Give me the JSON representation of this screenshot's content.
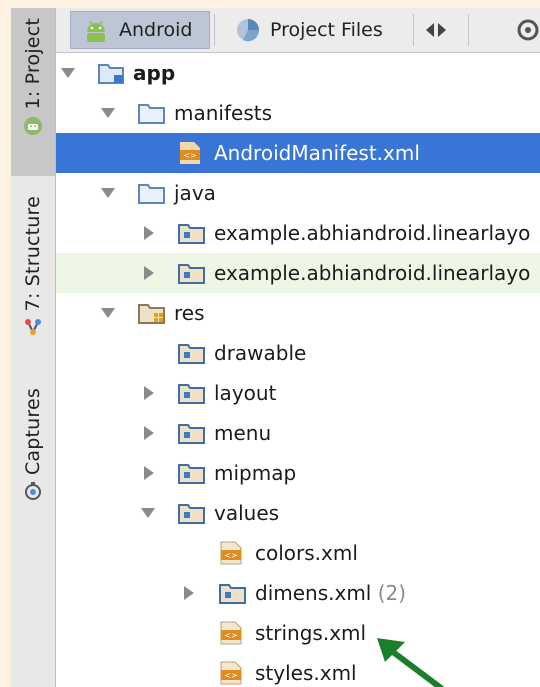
{
  "side_tabs": [
    {
      "label": "1: Project"
    },
    {
      "label": "7: Structure"
    },
    {
      "label": "Captures"
    }
  ],
  "toolbar": {
    "tabs": [
      {
        "label": "Android"
      },
      {
        "label": "Project Files"
      }
    ]
  },
  "tree": {
    "rows": [
      {
        "label": "app"
      },
      {
        "label": "manifests"
      },
      {
        "label": "AndroidManifest.xml"
      },
      {
        "label": "java"
      },
      {
        "label": "example.abhiandroid.linearlayo"
      },
      {
        "label": "example.abhiandroid.linearlayo"
      },
      {
        "label": "res"
      },
      {
        "label": "drawable"
      },
      {
        "label": "layout"
      },
      {
        "label": "menu"
      },
      {
        "label": "mipmap"
      },
      {
        "label": "values"
      },
      {
        "label": "colors.xml"
      },
      {
        "label": "dimens.xml",
        "count": "(2)"
      },
      {
        "label": "strings.xml"
      },
      {
        "label": "styles.xml"
      }
    ]
  },
  "colors": {
    "selection": "#3875d7",
    "highlight_row": "#eef6e5",
    "annotation_arrow": "#1a7f2b",
    "page_background": "#fdf2e2"
  },
  "icons": [
    "android-icon",
    "structure-icon",
    "captures-icon",
    "folder-icon",
    "xml-file-icon",
    "module-folder-icon",
    "package-folder-icon",
    "resources-folder-icon",
    "settings-icon"
  ]
}
